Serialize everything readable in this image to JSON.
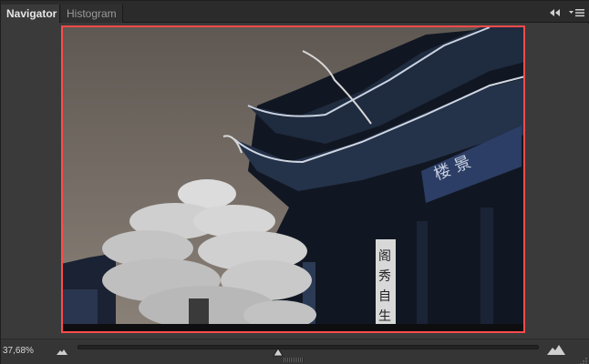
{
  "tabs": [
    {
      "label": "Navigator",
      "active": true
    },
    {
      "label": "Histogram",
      "active": false
    }
  ],
  "controls": {
    "collapse_icon": "double-chevron-left-icon",
    "menu_icon": "panel-menu-icon"
  },
  "preview": {
    "view_box_color": "#ff4a4a"
  },
  "zoom": {
    "value": "37,68%",
    "zoom_out_icon": "small-mountains-icon",
    "zoom_in_icon": "large-mountains-icon"
  },
  "photo_signs": {
    "plaque_text": "楼 景 ",
    "pillar_text": "阁 秀 自 生"
  }
}
